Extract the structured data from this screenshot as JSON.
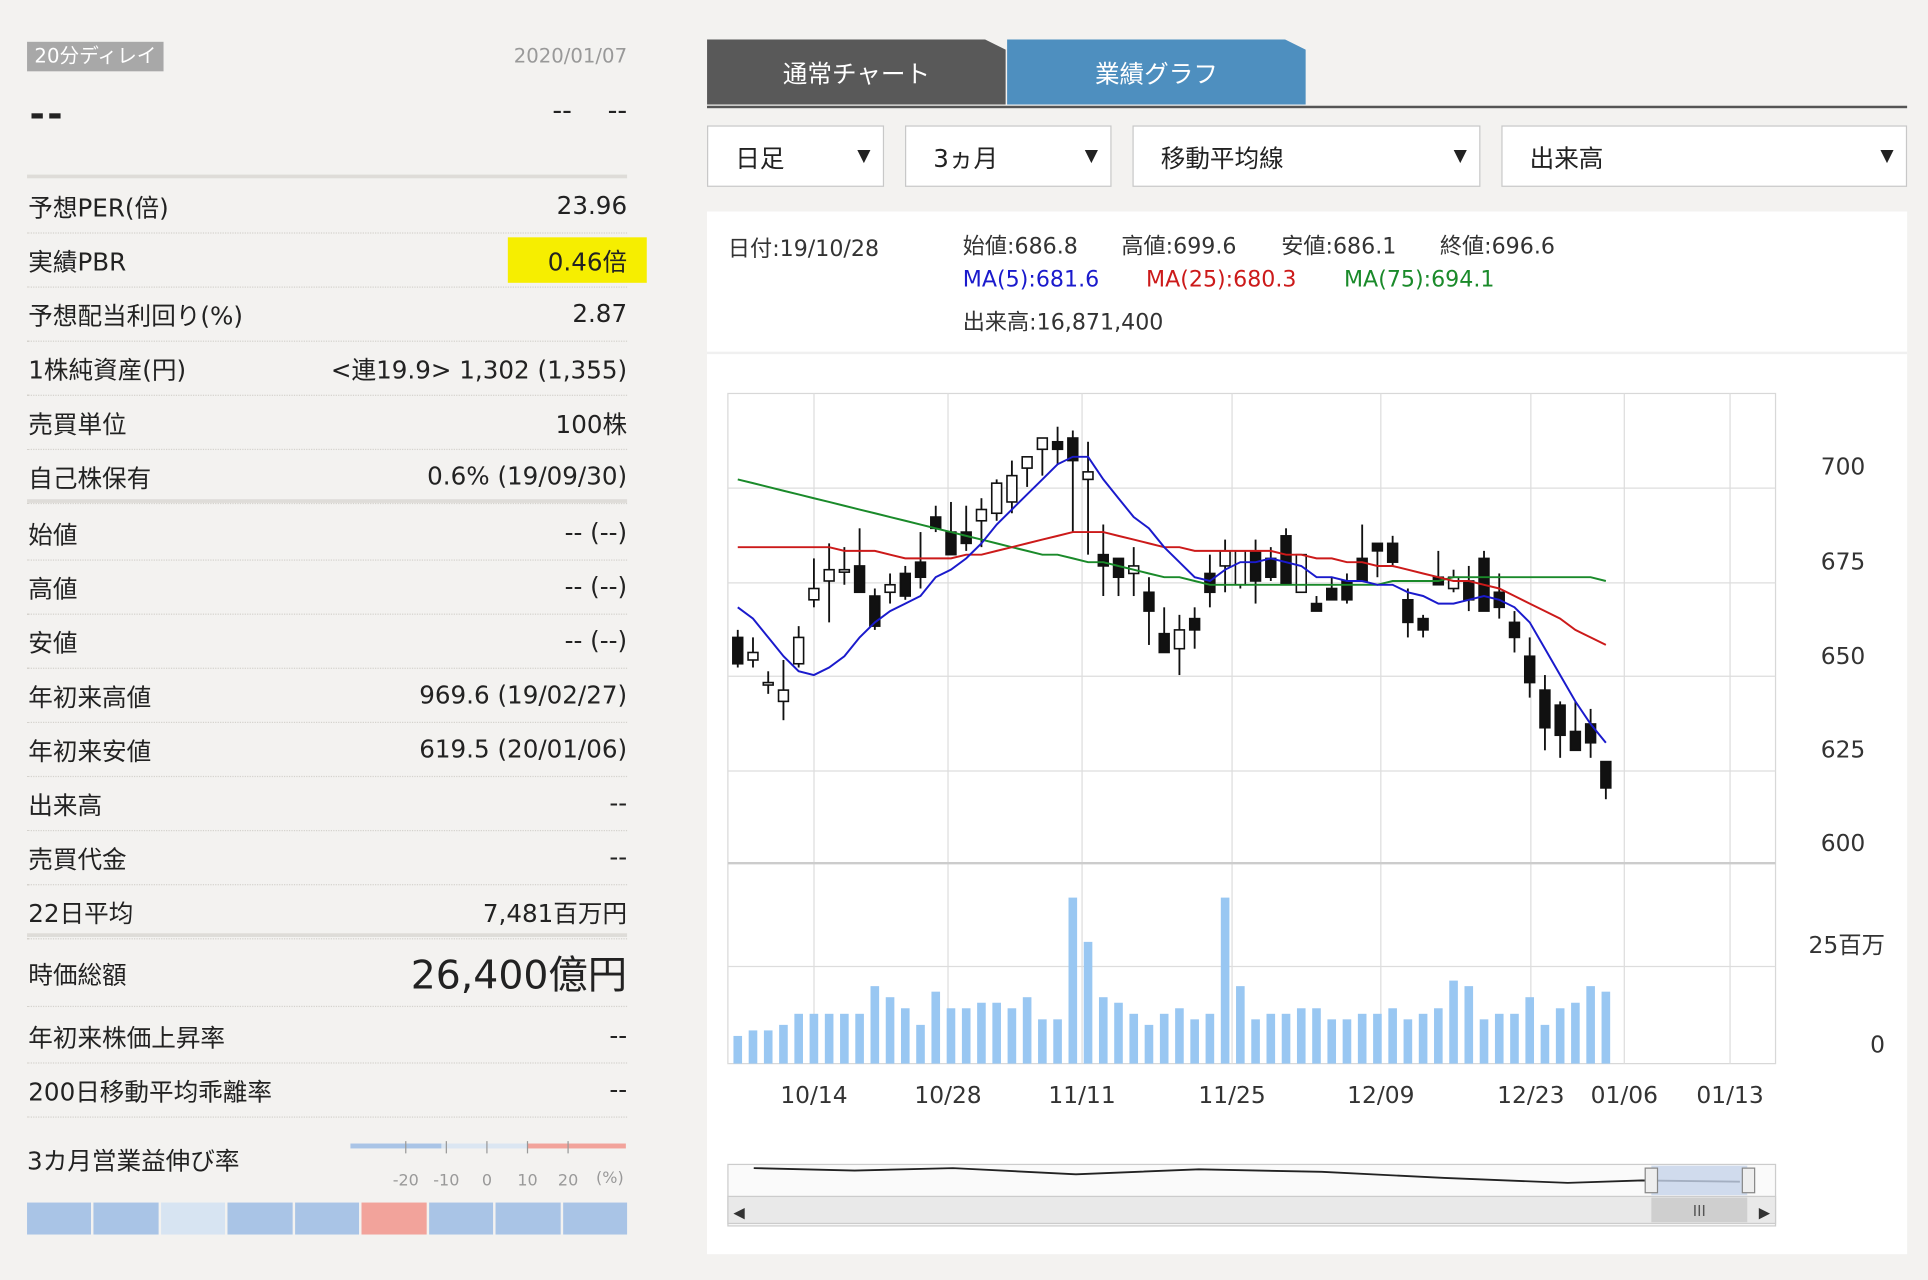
{
  "quote": {
    "delay_badge": "20分ディレイ",
    "date": "2020/01/07",
    "price": "--",
    "change": "-- --"
  },
  "rows1": [
    {
      "label": "予想PER(倍)",
      "value": "23.96"
    },
    {
      "label": "実績PBR",
      "value": "0.46倍"
    },
    {
      "label": "予想配当利回り(%)",
      "value": "2.87"
    },
    {
      "label": "1株純資産(円)",
      "value": "<連19.9> 1,302 (1,355)"
    },
    {
      "label": "売買単位",
      "value": "100株"
    },
    {
      "label": "自己株保有",
      "value": "0.6% (19/09/30)"
    }
  ],
  "rows2": [
    {
      "label": "始値",
      "value": "-- (--)"
    },
    {
      "label": "高値",
      "value": "-- (--)"
    },
    {
      "label": "安値",
      "value": "-- (--)"
    },
    {
      "label": "年初来高値",
      "value": "969.6 (19/02/27)"
    },
    {
      "label": "年初来安値",
      "value": "619.5 (20/01/06)"
    },
    {
      "label": "出来高",
      "value": "--"
    },
    {
      "label": "売買代金",
      "value": "--"
    },
    {
      "label": "22日平均",
      "value": "7,481百万円"
    }
  ],
  "rows3": [
    {
      "label": "時価総額",
      "value": "26,400億円"
    },
    {
      "label": "年初来株価上昇率",
      "value": "--"
    },
    {
      "label": "200日移動平均乖離率",
      "value": "--"
    }
  ],
  "growth": {
    "label": "3カ月営業益伸び率",
    "ticks": [
      "-20",
      "-10",
      "0",
      "10",
      "20"
    ],
    "unit": "(%)",
    "level_index": 5,
    "colors": {
      "neutral": "#a9c4e6",
      "light": "#d7e4f2",
      "hit": "#f2a39b"
    }
  },
  "tabs": [
    "通常チャート",
    "業績グラフ"
  ],
  "selects": {
    "period": "日足",
    "range": "3ヵ月",
    "indicator": "移動平均線",
    "lower": "出来高"
  },
  "info": {
    "date": "日付:19/10/28",
    "open": "始値:686.8",
    "high": "高値:699.6",
    "low": "安値:686.1",
    "close": "終値:696.6",
    "ma5": "MA(5):681.6",
    "ma25": "MA(25):680.3",
    "ma75": "MA(75):694.1",
    "volume": "出来高:16,871,400"
  },
  "chart_data": {
    "type": "candlestick",
    "price_ticks": [
      "700",
      "675",
      "650",
      "625",
      "600"
    ],
    "volume_ticks": [
      "25百万",
      "0"
    ],
    "x_ticks": [
      "10/14",
      "10/28",
      "11/11",
      "11/25",
      "12/09",
      "12/23",
      "01/06",
      "01/13"
    ],
    "ylim": [
      600,
      710
    ],
    "colors": {
      "ma5": "#1a1acc",
      "ma25": "#cc1a1a",
      "ma75": "#1a8a2a",
      "volume": "#99c7f2"
    },
    "candles": [
      [
        660,
        662,
        652,
        653
      ],
      [
        654,
        660,
        652,
        656
      ],
      [
        648,
        651,
        645,
        648
      ],
      [
        643,
        654,
        638,
        646
      ],
      [
        653,
        663,
        652,
        660
      ],
      [
        670,
        681,
        668,
        673
      ],
      [
        675,
        685,
        664,
        678
      ],
      [
        678,
        684,
        674,
        678
      ],
      [
        679,
        689,
        675,
        672
      ],
      [
        671,
        673,
        662,
        663
      ],
      [
        672,
        677,
        669,
        674
      ],
      [
        677,
        679,
        670,
        671
      ],
      [
        680,
        688,
        673,
        676
      ],
      [
        692,
        695,
        688,
        689
      ],
      [
        688,
        696,
        684,
        682
      ],
      [
        688,
        695,
        683,
        685
      ],
      [
        691,
        697,
        684,
        694
      ],
      [
        693,
        702,
        691,
        701
      ],
      [
        696,
        707,
        693,
        703
      ],
      [
        705,
        708,
        700,
        708
      ],
      [
        710,
        712,
        703,
        713
      ],
      [
        712,
        716,
        706,
        710
      ],
      [
        713,
        715,
        688,
        707
      ],
      [
        702,
        712,
        682,
        704
      ],
      [
        682,
        690,
        671,
        679
      ],
      [
        681,
        681,
        671,
        676
      ],
      [
        677,
        684,
        671,
        679
      ],
      [
        672,
        676,
        658,
        667
      ],
      [
        661,
        668,
        657,
        656
      ],
      [
        657,
        666,
        650,
        662
      ],
      [
        665,
        668,
        657,
        662
      ],
      [
        677,
        682,
        668,
        672
      ],
      [
        679,
        686,
        672,
        683
      ],
      [
        674,
        682,
        673,
        683
      ],
      [
        683,
        686,
        669,
        675
      ],
      [
        681,
        684,
        675,
        676
      ],
      [
        687,
        689,
        678,
        674
      ],
      [
        672,
        676,
        672,
        682
      ],
      [
        669,
        671,
        667,
        667
      ],
      [
        673,
        676,
        670,
        670
      ],
      [
        675,
        677,
        669,
        670
      ],
      [
        681,
        690,
        677,
        675
      ],
      [
        685,
        684,
        676,
        683
      ],
      [
        685,
        687,
        679,
        680
      ],
      [
        670,
        673,
        660,
        664
      ],
      [
        665,
        666,
        660,
        662
      ],
      [
        676,
        683,
        674,
        674
      ],
      [
        673,
        678,
        672,
        676
      ],
      [
        675,
        679,
        667,
        670
      ],
      [
        681,
        683,
        669,
        667
      ],
      [
        672,
        677,
        665,
        668
      ],
      [
        664,
        667,
        656,
        660
      ],
      [
        655,
        660,
        644,
        648
      ],
      [
        646,
        650,
        630,
        636
      ],
      [
        642,
        643,
        628,
        634
      ],
      [
        635,
        643,
        631,
        630
      ],
      [
        637,
        641,
        628,
        632
      ],
      [
        627,
        625,
        617,
        620
      ]
    ],
    "ma5": [
      668,
      665,
      660,
      655,
      651,
      650,
      652,
      655,
      660,
      664,
      667,
      669,
      671,
      676,
      678,
      681,
      685,
      690,
      694,
      698,
      702,
      706,
      708,
      708,
      702,
      697,
      692,
      689,
      684,
      680,
      676,
      675,
      678,
      680,
      680,
      681,
      680,
      679,
      676,
      676,
      675,
      675,
      674,
      674,
      672,
      671,
      669,
      669,
      670,
      671,
      670,
      668,
      664,
      657,
      650,
      643,
      637,
      632
    ],
    "ma25": [
      684,
      684,
      684,
      684,
      684,
      684,
      684,
      683,
      683,
      683,
      682,
      681,
      681,
      681,
      681,
      682,
      682,
      683,
      684,
      685,
      686,
      687,
      688,
      688,
      688,
      687,
      686,
      685,
      684,
      684,
      683,
      683,
      683,
      683,
      683,
      683,
      682,
      682,
      681,
      681,
      680,
      680,
      679,
      679,
      678,
      677,
      676,
      675,
      675,
      674,
      673,
      671,
      669,
      667,
      665,
      662,
      660,
      658
    ],
    "ma75": [
      702,
      701,
      700,
      699,
      698,
      697,
      696,
      695,
      694,
      693,
      692,
      691,
      690,
      689,
      688,
      687,
      686,
      685,
      684,
      683,
      682,
      682,
      681,
      680,
      680,
      679,
      678,
      677,
      676,
      676,
      675,
      674,
      674,
      674,
      674,
      674,
      674,
      674,
      674,
      674,
      674,
      674,
      674,
      675,
      675,
      675,
      675,
      676,
      676,
      676,
      676,
      676,
      676,
      676,
      676,
      676,
      676,
      675
    ],
    "volume": [
      5,
      6,
      6,
      7,
      9,
      9,
      9,
      9,
      9,
      14,
      12,
      10,
      7,
      13,
      10,
      10,
      11,
      11,
      10,
      12,
      8,
      8,
      30,
      22,
      12,
      11,
      9,
      7,
      9,
      10,
      8,
      9,
      30,
      14,
      8,
      9,
      9,
      10,
      10,
      8,
      8,
      9,
      9,
      10,
      8,
      9,
      10,
      15,
      14,
      8,
      9,
      9,
      12,
      7,
      10,
      11,
      14,
      13
    ]
  }
}
